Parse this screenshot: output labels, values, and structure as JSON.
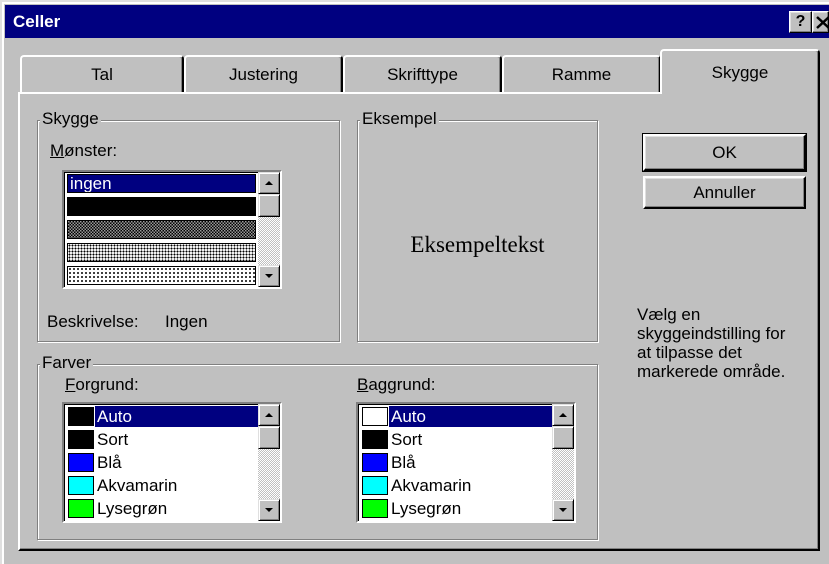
{
  "theme": {
    "title_bar": "#000080",
    "face": "#c0c0c0",
    "selection": "#000080"
  },
  "window": {
    "title": "Celler",
    "help_label": "?"
  },
  "tabs": [
    {
      "label": "Tal"
    },
    {
      "label": "Justering"
    },
    {
      "label": "Skrifttype"
    },
    {
      "label": "Ramme"
    },
    {
      "label": "Skygge",
      "active": true
    }
  ],
  "shading": {
    "group_label": "Skygge",
    "pattern_label": "Mønster:",
    "selected_pattern": "ingen",
    "description_label": "Beskrivelse:",
    "description_value": "Ingen"
  },
  "example": {
    "group_label": "Eksempel",
    "sample_text": "Eksempeltekst"
  },
  "buttons": {
    "ok": "OK",
    "cancel": "Annuller"
  },
  "hint": "Vælg en\nskyggeindstilling for\nat tilpasse det\nmarkerede område.",
  "colors": {
    "group_label": "Farver",
    "foreground": {
      "label": "Forgrund:",
      "items": [
        {
          "label": "Auto",
          "color": "#000000",
          "selected": true
        },
        {
          "label": "Sort",
          "color": "#000000"
        },
        {
          "label": "Blå",
          "color": "#0000ff"
        },
        {
          "label": "Akvamarin",
          "color": "#00ffff"
        },
        {
          "label": "Lysegrøn",
          "color": "#00ff00"
        }
      ]
    },
    "background": {
      "label": "Baggrund:",
      "items": [
        {
          "label": "Auto",
          "color": "#ffffff",
          "selected": true
        },
        {
          "label": "Sort",
          "color": "#000000"
        },
        {
          "label": "Blå",
          "color": "#0000ff"
        },
        {
          "label": "Akvamarin",
          "color": "#00ffff"
        },
        {
          "label": "Lysegrøn",
          "color": "#00ff00"
        }
      ]
    }
  }
}
